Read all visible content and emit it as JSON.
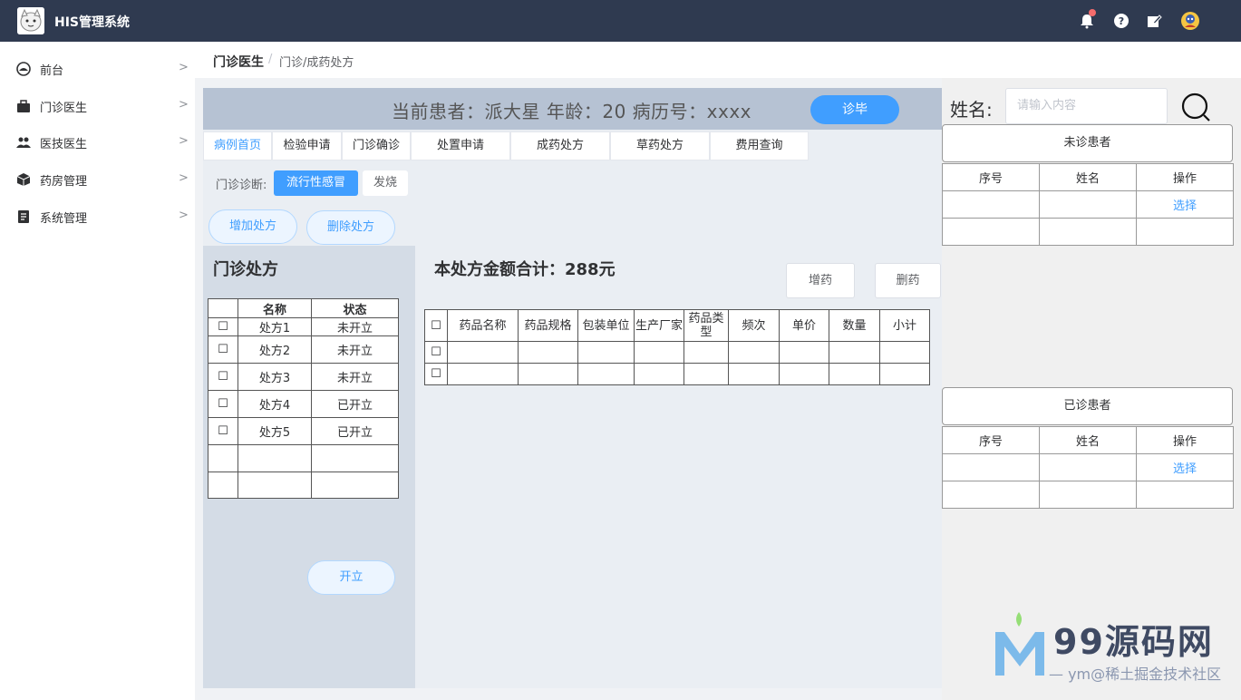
{
  "header": {
    "app_title": "HIS管理系统",
    "icons": [
      "bell-icon",
      "help-icon",
      "edit-icon",
      "avatar"
    ],
    "bar_color": "#2f3a50"
  },
  "sidebar": {
    "items": [
      {
        "label": "前台",
        "icon": "dashboard-icon"
      },
      {
        "label": "门诊医生",
        "icon": "briefcase-icon"
      },
      {
        "label": "医技医生",
        "icon": "users-icon"
      },
      {
        "label": "药房管理",
        "icon": "box-icon"
      },
      {
        "label": "系统管理",
        "icon": "document-icon"
      }
    ],
    "arrow": ">"
  },
  "breadcrumb": {
    "main": "门诊医生",
    "separator": "/",
    "sub": "门诊/成药处方"
  },
  "patient": {
    "info": "当前患者：派大星  年龄：20  病历号：xxxx",
    "done_button": "诊毕"
  },
  "tabs": [
    "病例首页",
    "检验申请",
    "门诊确诊",
    "处置申请",
    "成药处方",
    "草药处方",
    "费用查询"
  ],
  "diagnosis": {
    "label": "门诊诊断:",
    "tags": [
      "流行性感冒",
      "发烧"
    ]
  },
  "actions": {
    "add_rx": "增加处方",
    "delete_rx": "删除处方",
    "open_rx": "开立"
  },
  "rx_panel": {
    "title": "门诊处方",
    "headers": [
      "",
      "名称",
      "状态"
    ],
    "rows": [
      {
        "check": "☐",
        "name": "处方1",
        "status": "未开立"
      },
      {
        "check": "☐",
        "name": "处方2",
        "status": "未开立"
      },
      {
        "check": "☐",
        "name": "处方3",
        "status": "未开立"
      },
      {
        "check": "☐",
        "name": "处方4",
        "status": "已开立"
      },
      {
        "check": "☐",
        "name": "处方5",
        "status": "已开立"
      }
    ]
  },
  "drug_panel": {
    "total": "本处方金额合计：288元",
    "add_drug": "增药",
    "delete_drug": "删药",
    "headers": [
      "☐",
      "药品名称",
      "药品规格",
      "包装单位",
      "生产厂家",
      "药品类型",
      "频次",
      "单价",
      "数量",
      "小计"
    ],
    "row_checks": [
      "☐",
      "☐"
    ]
  },
  "search": {
    "label": "姓名:",
    "placeholder": "请输入内容"
  },
  "waiting": {
    "title": "未诊患者",
    "headers": [
      "序号",
      "姓名",
      "操作"
    ],
    "action": "选择"
  },
  "finished": {
    "title": "已诊患者",
    "headers": [
      "序号",
      "姓名",
      "操作"
    ],
    "action": "选择"
  },
  "watermark": {
    "brand": "99源码网",
    "sub": "— ym@稀土掘金技术社区"
  },
  "colors": {
    "accent": "#409eff",
    "patient_bar": "#b6c2d3",
    "panel_bg": "#d4dce6"
  }
}
